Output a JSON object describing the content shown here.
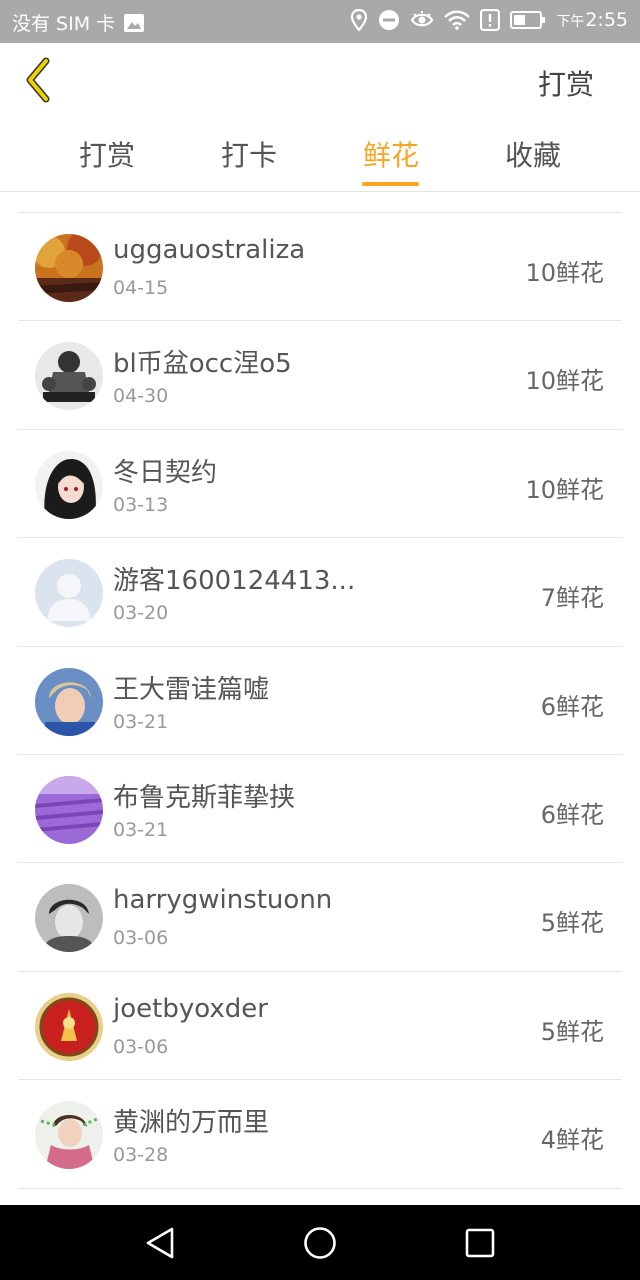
{
  "status_bar": {
    "carrier": "没有 SIM 卡",
    "clock_prefix": "下午",
    "clock_time": "2:55"
  },
  "header": {
    "action_label": "打赏"
  },
  "tabs": [
    {
      "label": "打赏",
      "active": false
    },
    {
      "label": "打卡",
      "active": false
    },
    {
      "label": "鲜花",
      "active": true
    },
    {
      "label": "收藏",
      "active": false
    }
  ],
  "colors": {
    "accent": "#f5a623",
    "back_arrow": "#f0d000",
    "status_bar_bg": "#a9a9a9"
  },
  "rows": [
    {
      "name": "uggauostraliza",
      "date": "04-15",
      "amount": "10鲜花",
      "avatar_icon": "autumn-trees-avatar"
    },
    {
      "name": "bl币盆occ涅o5",
      "date": "04-30",
      "amount": "10鲜花",
      "avatar_icon": "group-photo-avatar"
    },
    {
      "name": "冬日契约",
      "date": "03-13",
      "amount": "10鲜花",
      "avatar_icon": "anime-girl-avatar"
    },
    {
      "name": "游客1600124413...",
      "date": "03-20",
      "amount": "7鲜花",
      "avatar_icon": "default-user-avatar"
    },
    {
      "name": "王大雷诖篇嘘",
      "date": "03-21",
      "amount": "6鲜花",
      "avatar_icon": "boy-photo-avatar"
    },
    {
      "name": "布鲁克斯菲挚挟",
      "date": "03-21",
      "amount": "6鲜花",
      "avatar_icon": "lavender-field-avatar"
    },
    {
      "name": "harrygwinstuonn",
      "date": "03-06",
      "amount": "5鲜花",
      "avatar_icon": "bw-portrait-avatar"
    },
    {
      "name": "joetbyoxder",
      "date": "03-06",
      "amount": "5鲜花",
      "avatar_icon": "red-emblem-avatar"
    },
    {
      "name": "黄渊的万而里",
      "date": "03-28",
      "amount": "4鲜花",
      "avatar_icon": "pink-scarf-avatar"
    }
  ]
}
